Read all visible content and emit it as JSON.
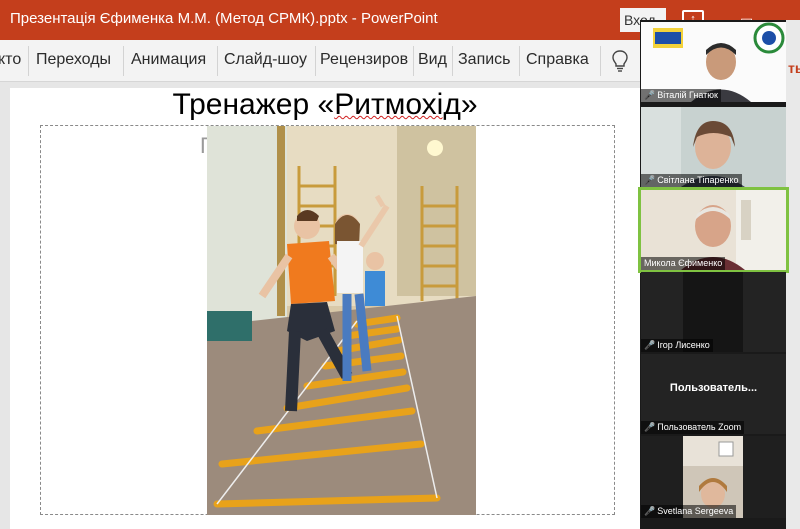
{
  "window": {
    "title": "Презентація Єфименка М.М. (Метод СРМК).pptx  -  PowerPoint",
    "login_button": "Вход"
  },
  "ribbon": {
    "tabs": [
      "кто",
      "Переходы",
      "Анимация",
      "Слайд-шоу",
      "Рецензиров",
      "Вид",
      "Запись",
      "Справка"
    ],
    "right_fragment": "ть"
  },
  "slide": {
    "title_prefix": "Тренажер «",
    "title_word": "Ритмохід",
    "title_suffix": "»",
    "ghost_text": "П"
  },
  "participants": [
    {
      "name": "Віталій Гнатюк",
      "muted": true
    },
    {
      "name": "Світлана Тіпаренко",
      "muted": true
    },
    {
      "name": "Микола Єфименко",
      "muted": false
    },
    {
      "name": "Ігор Лисенко",
      "muted": true
    },
    {
      "name": "Пользователь Zoom",
      "muted": true,
      "center_label": "Пользователь..."
    },
    {
      "name": "Svetlana Sergeeva",
      "muted": true
    }
  ],
  "colors": {
    "titlebar": "#c43e1c",
    "ribbon": "#f3f3f3",
    "mute_red": "#e53935"
  }
}
